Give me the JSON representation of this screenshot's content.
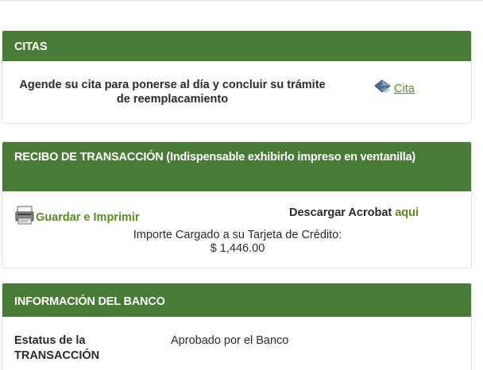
{
  "citas": {
    "header": "CITAS",
    "text": "Agende su cita para ponerse al día y concluir su trámite de reemplacamiento",
    "link_label": "Cita"
  },
  "recibo": {
    "header": "RECIBO DE TRANSACCIÓN (Indispensable exhibirlo impreso en ventanilla)",
    "save_label": "Guardar e Imprimir",
    "acrobat_text": "Descargar Acrobat",
    "acrobat_link": "aqui",
    "importe_label": "Importe Cargado a su Tarjeta de Crédito:",
    "importe_value": "$ 1,446.00"
  },
  "banco": {
    "header": "INFORMACIÓN DEL BANCO",
    "status_label": "Estatus de la TRANSACCIÓN",
    "status_value": "Aprobado por el Banco"
  },
  "colors": {
    "header_green": "#4a7b36",
    "link_green": "#5a8a22"
  },
  "icons": {
    "cita": "calendar-diamond-icon",
    "save": "printer-icon"
  }
}
